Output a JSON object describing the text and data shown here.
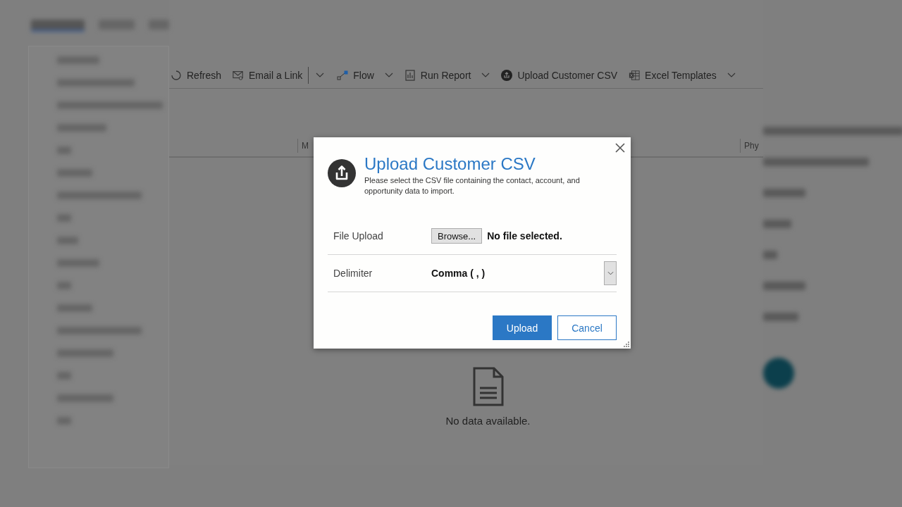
{
  "toolbar": {
    "items": [
      {
        "kind": "refresh",
        "label": "Refresh",
        "dropdown": false
      },
      {
        "kind": "email",
        "label": "Email a Link",
        "dropdown": false
      },
      {
        "kind": "more"
      },
      {
        "kind": "flow",
        "label": "Flow",
        "dropdown": true
      },
      {
        "kind": "report",
        "label": "Run Report",
        "dropdown": true
      },
      {
        "kind": "upload",
        "label": "Upload Customer CSV",
        "dropdown": false
      },
      {
        "kind": "excel",
        "label": "Excel Templates",
        "dropdown": true
      }
    ]
  },
  "grid": {
    "columns": [
      "M",
      "Phy"
    ],
    "empty_message": "No data available."
  },
  "dialog": {
    "title": "Upload Customer CSV",
    "description": "Please select the CSV file containing the contact, account, and opportunity data to import.",
    "file_upload": {
      "label": "File Upload",
      "button": "Browse...",
      "status": "No file selected."
    },
    "delimiter": {
      "label": "Delimiter",
      "value": "Comma ( , )"
    },
    "buttons": [
      {
        "label": "Upload",
        "primary": true
      },
      {
        "label": "Cancel",
        "primary": false
      }
    ]
  }
}
